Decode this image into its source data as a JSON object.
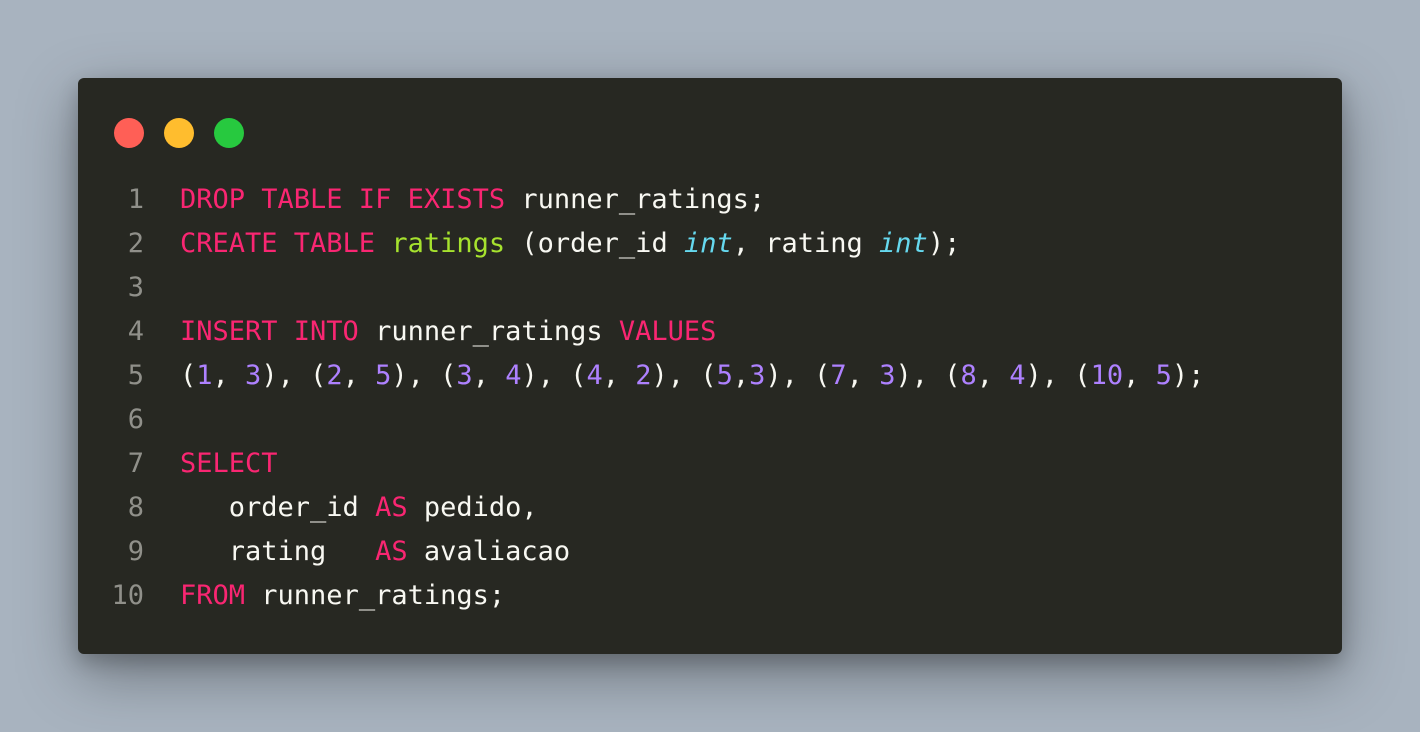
{
  "window": {
    "buttons": [
      {
        "name": "close",
        "color": "#ff5f56"
      },
      {
        "name": "minimize",
        "color": "#ffbd2e"
      },
      {
        "name": "maximize",
        "color": "#27c93f"
      }
    ]
  },
  "code": {
    "lines": [
      {
        "n": "1",
        "tokens": [
          {
            "t": "kw",
            "s": "DROP TABLE IF EXISTS"
          },
          {
            "t": "pl",
            "s": " runner_ratings;"
          }
        ]
      },
      {
        "n": "2",
        "tokens": [
          {
            "t": "kw",
            "s": "CREATE TABLE"
          },
          {
            "t": "pl",
            "s": " "
          },
          {
            "t": "fn",
            "s": "ratings"
          },
          {
            "t": "pl",
            "s": " (order_id "
          },
          {
            "t": "ty",
            "s": "int"
          },
          {
            "t": "pl",
            "s": ", rating "
          },
          {
            "t": "ty",
            "s": "int"
          },
          {
            "t": "pl",
            "s": ");"
          }
        ]
      },
      {
        "n": "3",
        "tokens": []
      },
      {
        "n": "4",
        "tokens": [
          {
            "t": "kw",
            "s": "INSERT INTO"
          },
          {
            "t": "pl",
            "s": " runner_ratings "
          },
          {
            "t": "kw",
            "s": "VALUES"
          }
        ]
      },
      {
        "n": "5",
        "tokens": [
          {
            "t": "pl",
            "s": "("
          },
          {
            "t": "num",
            "s": "1"
          },
          {
            "t": "pl",
            "s": ", "
          },
          {
            "t": "num",
            "s": "3"
          },
          {
            "t": "pl",
            "s": "), ("
          },
          {
            "t": "num",
            "s": "2"
          },
          {
            "t": "pl",
            "s": ", "
          },
          {
            "t": "num",
            "s": "5"
          },
          {
            "t": "pl",
            "s": "), ("
          },
          {
            "t": "num",
            "s": "3"
          },
          {
            "t": "pl",
            "s": ", "
          },
          {
            "t": "num",
            "s": "4"
          },
          {
            "t": "pl",
            "s": "), ("
          },
          {
            "t": "num",
            "s": "4"
          },
          {
            "t": "pl",
            "s": ", "
          },
          {
            "t": "num",
            "s": "2"
          },
          {
            "t": "pl",
            "s": "), ("
          },
          {
            "t": "num",
            "s": "5"
          },
          {
            "t": "pl",
            "s": ","
          },
          {
            "t": "num",
            "s": "3"
          },
          {
            "t": "pl",
            "s": "), ("
          },
          {
            "t": "num",
            "s": "7"
          },
          {
            "t": "pl",
            "s": ", "
          },
          {
            "t": "num",
            "s": "3"
          },
          {
            "t": "pl",
            "s": "), ("
          },
          {
            "t": "num",
            "s": "8"
          },
          {
            "t": "pl",
            "s": ", "
          },
          {
            "t": "num",
            "s": "4"
          },
          {
            "t": "pl",
            "s": "), ("
          },
          {
            "t": "num",
            "s": "10"
          },
          {
            "t": "pl",
            "s": ", "
          },
          {
            "t": "num",
            "s": "5"
          },
          {
            "t": "pl",
            "s": ");"
          }
        ]
      },
      {
        "n": "6",
        "tokens": []
      },
      {
        "n": "7",
        "tokens": [
          {
            "t": "kw",
            "s": "SELECT"
          }
        ]
      },
      {
        "n": "8",
        "tokens": [
          {
            "t": "pl",
            "s": "   order_id "
          },
          {
            "t": "kw",
            "s": "AS"
          },
          {
            "t": "pl",
            "s": " pedido,"
          }
        ]
      },
      {
        "n": "9",
        "tokens": [
          {
            "t": "pl",
            "s": "   rating   "
          },
          {
            "t": "kw",
            "s": "AS"
          },
          {
            "t": "pl",
            "s": " avaliacao"
          }
        ]
      },
      {
        "n": "10",
        "tokens": [
          {
            "t": "kw",
            "s": "FROM"
          },
          {
            "t": "pl",
            "s": " runner_ratings;"
          }
        ]
      }
    ]
  },
  "theme": {
    "background": "#272822",
    "keyword": "#f92672",
    "function": "#a6e22e",
    "type": "#66d9ef",
    "number": "#ae81ff",
    "text": "#f8f8f2",
    "line_number": "#90908a"
  }
}
